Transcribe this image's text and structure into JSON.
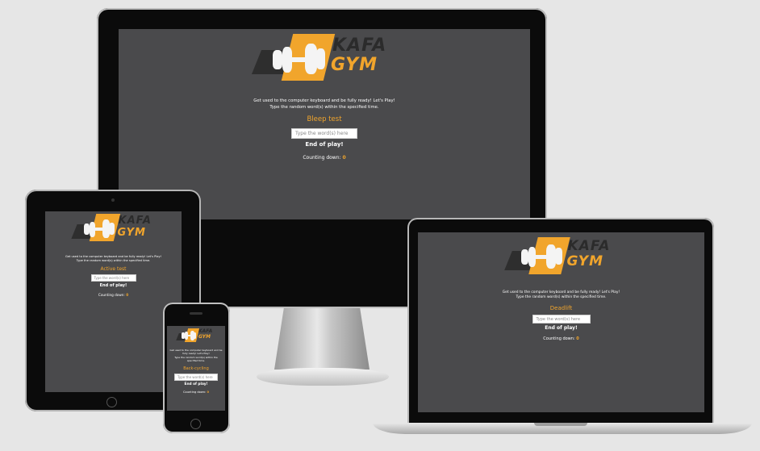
{
  "logo": {
    "kafa": "KAFA",
    "gym": "GYM"
  },
  "devices": {
    "desktop": {
      "intro_line1": "Get used to the computer keyboard and be fully ready! Let's Play!",
      "intro_line2": "Type the random word(s) within the specified time.",
      "test_name": "Bleep test",
      "input_placeholder": "Type the word(s) here",
      "end_label": "End of play!",
      "countdown_label": "Counting down:",
      "countdown_value": "0"
    },
    "tablet": {
      "intro_line1": "Get used to the computer keyboard and be fully ready! Let's Play!",
      "intro_line2": "Type the random word(s) within the specified time.",
      "test_name": "Active test",
      "input_placeholder": "Type the word(s) here",
      "end_label": "End of play!",
      "countdown_label": "Counting down:",
      "countdown_value": "0"
    },
    "laptop": {
      "intro_line1": "Get used to the computer keyboard and be fully ready! Let's Play!",
      "intro_line2": "Type the random word(s) within the specified time.",
      "test_name": "Deadlift",
      "input_placeholder": "Type the word(s) here",
      "end_label": "End of play!",
      "countdown_label": "Counting down:",
      "countdown_value": "0"
    },
    "phone": {
      "intro_line1": "Get used to the computer keyboard and be fully ready! Let's Play!",
      "intro_line2": "Type the random word(s) within the specified time.",
      "test_name": "Back-cycling",
      "input_placeholder": "Type the word(s) here",
      "end_label": "End of play!",
      "countdown_label": "Counting down:",
      "countdown_value": "0"
    }
  },
  "colors": {
    "accent": "#f1a52c",
    "screen_bg": "#4a4a4c",
    "page_bg": "#e6e6e6"
  }
}
